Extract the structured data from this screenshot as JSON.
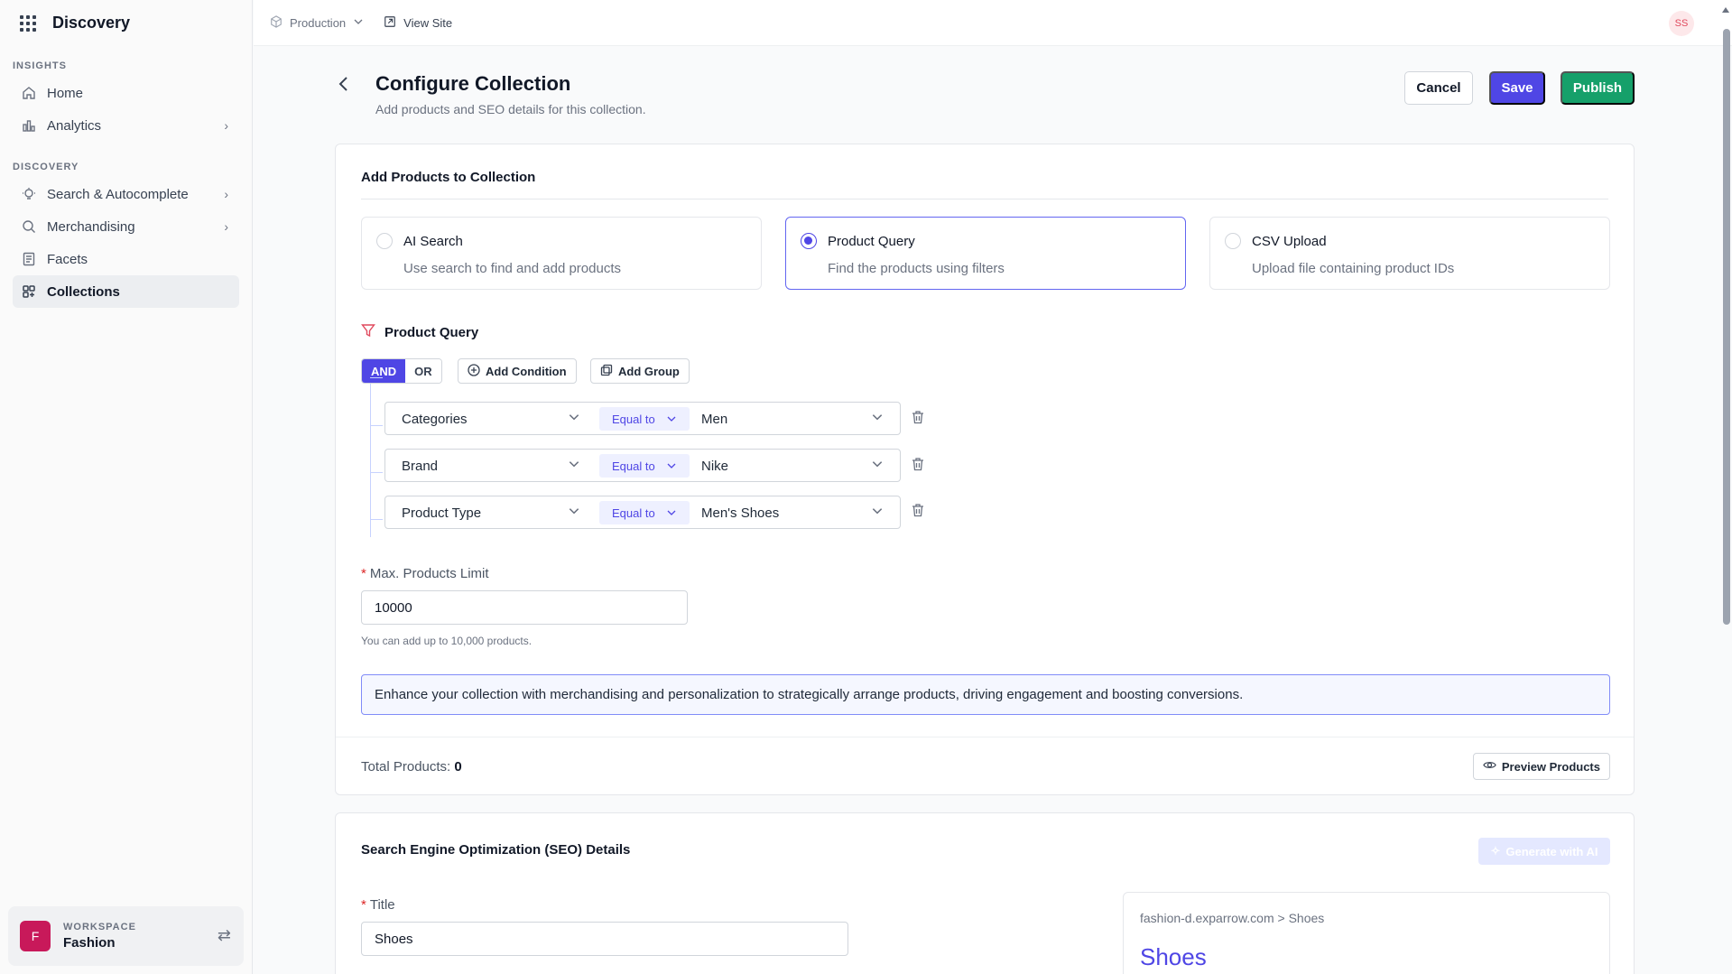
{
  "app": {
    "name": "Discovery"
  },
  "sidebar": {
    "sections": [
      {
        "label": "INSIGHTS"
      },
      {
        "label": "DISCOVERY"
      }
    ],
    "items": [
      {
        "label": "Home",
        "icon": "home-icon"
      },
      {
        "label": "Analytics",
        "icon": "chart-icon"
      },
      {
        "label": "Search & Autocomplete",
        "icon": "bulb-icon"
      },
      {
        "label": "Merchandising",
        "icon": "search-icon"
      },
      {
        "label": "Facets",
        "icon": "list-icon"
      },
      {
        "label": "Collections",
        "icon": "grid-icon",
        "active": true
      }
    ],
    "workspace": {
      "label": "WORKSPACE",
      "name": "Fashion",
      "initial": "F"
    }
  },
  "topbar": {
    "environment": "Production",
    "view_site": "View Site",
    "user_initials": "SS"
  },
  "header": {
    "title": "Configure Collection",
    "subtitle": "Add products and SEO details for this collection.",
    "cancel": "Cancel",
    "save": "Save",
    "publish": "Publish"
  },
  "products": {
    "title": "Add Products to Collection",
    "options": [
      {
        "title": "AI Search",
        "desc": "Use search to find and add products",
        "selected": false
      },
      {
        "title": "Product Query",
        "desc": "Find the products using filters",
        "selected": true
      },
      {
        "title": "CSV Upload",
        "desc": "Upload file containing product IDs",
        "selected": false
      }
    ],
    "query": {
      "label": "Product Query",
      "and": "AND",
      "or": "OR",
      "add_condition": "Add Condition",
      "add_group": "Add Group",
      "conditions": [
        {
          "field": "Categories",
          "op": "Equal to",
          "value": "Men"
        },
        {
          "field": "Brand",
          "op": "Equal to",
          "value": "Nike"
        },
        {
          "field": "Product Type",
          "op": "Equal to",
          "value": "Men's Shoes"
        }
      ]
    },
    "limit": {
      "label": "Max. Products Limit",
      "value": "10000",
      "hint": "You can add up to 10,000 products."
    },
    "banner": "Enhance your collection with merchandising and personalization to strategically arrange products, driving engagement and boosting conversions.",
    "total_label": "Total Products:",
    "total_value": "0",
    "preview": "Preview Products"
  },
  "seo": {
    "title": "Search Engine Optimization (SEO) Details",
    "generate": "Generate with AI",
    "field_label": "Title",
    "field_value": "Shoes",
    "preview_url": "fashion-d.exparrow.com > Shoes",
    "preview_title": "Shoes"
  }
}
